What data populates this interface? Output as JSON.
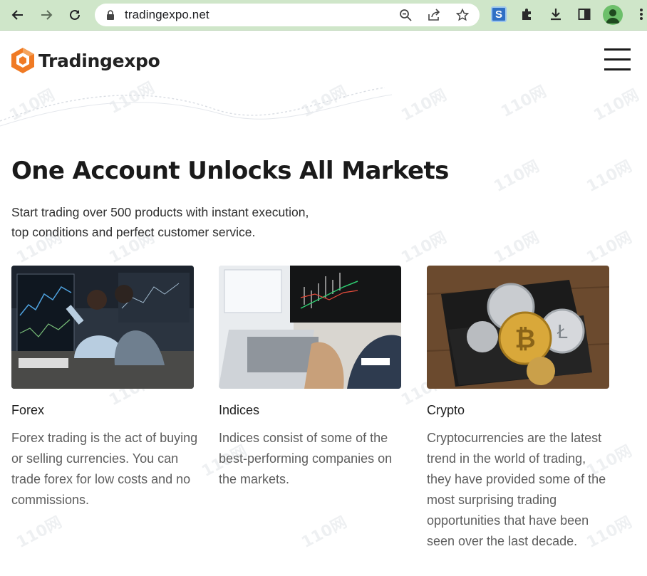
{
  "browser": {
    "url": "tradingexpo.net",
    "extension_label": "S"
  },
  "site": {
    "brand": "Tradingexpo"
  },
  "hero": {
    "headline": "One Account Unlocks All Markets",
    "subtext_line1": "Start trading over 500 products with instant execution,",
    "subtext_line2": "top conditions and perfect customer service."
  },
  "cards": [
    {
      "title": "Forex",
      "description": "Forex trading is the act of buying or selling currencies. You can trade forex for low costs and no commissions."
    },
    {
      "title": "Indices",
      "description": "Indices consist of some of the best-performing companies on the markets."
    },
    {
      "title": "Crypto",
      "description": "Cryptocurrencies are the latest trend in the world of trading, they have provided some of the most surprising trading opportunities that have been seen over the last decade."
    }
  ],
  "watermark": "110网",
  "colors": {
    "chrome": "#cfe6c9",
    "brand_orange": "#f07a24",
    "text_dark": "#1a1a1a",
    "text_muted": "#5d5d5d"
  }
}
